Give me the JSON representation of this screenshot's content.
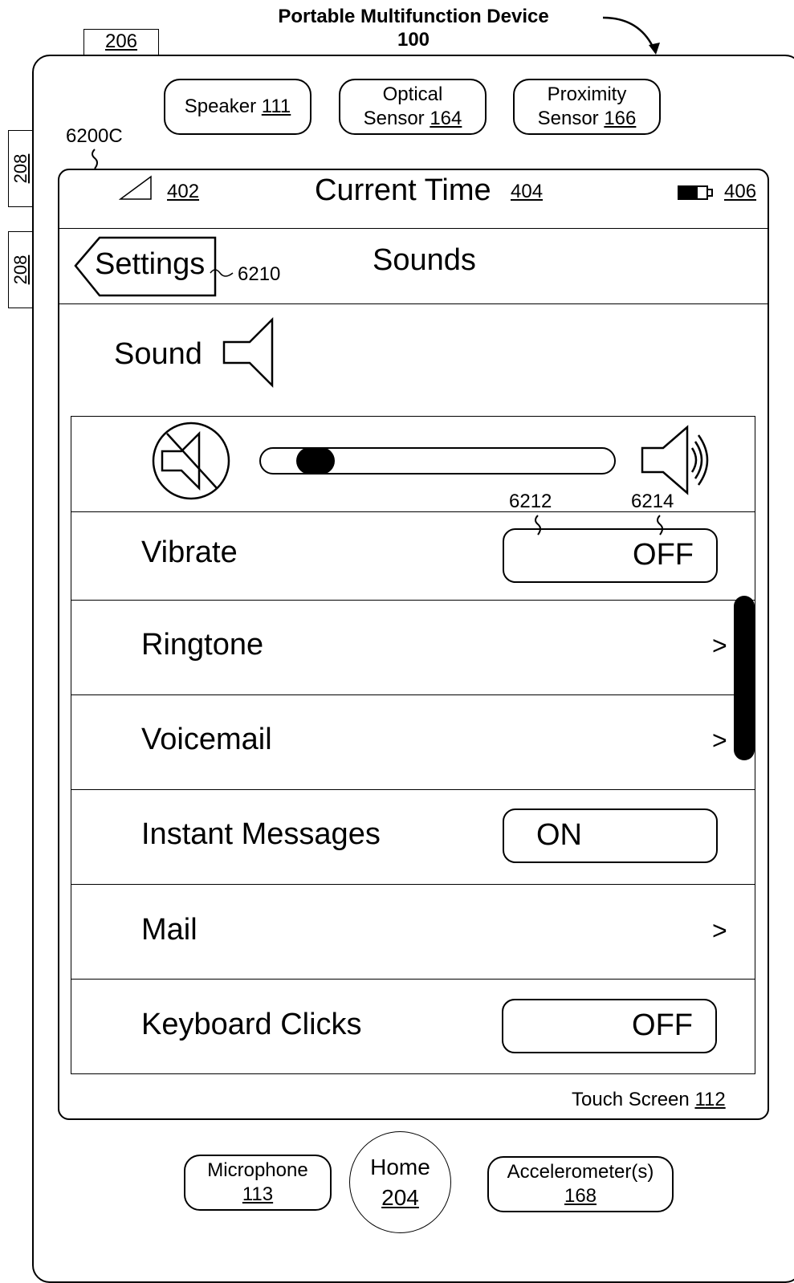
{
  "figure": {
    "title": "Portable Multifunction Device",
    "device_ref": "100",
    "tab_ref": "206",
    "side_button_ref": "208",
    "screen_ref": "6200C",
    "settings_button_ref": "6210",
    "toggle_track_ref": "6212",
    "toggle_thumb_ref": "6214"
  },
  "hardware": {
    "speaker": {
      "label": "Speaker",
      "ref": "111"
    },
    "optical_sensor": {
      "line1": "Optical",
      "label": "Sensor",
      "ref": "164"
    },
    "proximity_sensor": {
      "line1": "Proximity",
      "label": "Sensor",
      "ref": "166"
    },
    "microphone": {
      "label": "Microphone",
      "ref": "113"
    },
    "home": {
      "label": "Home",
      "ref": "204"
    },
    "accelerometer": {
      "label": "Accelerometer(s)",
      "ref": "168"
    }
  },
  "status_bar": {
    "signal_ref": "402",
    "time_label": "Current Time",
    "time_ref": "404",
    "battery_ref": "406"
  },
  "nav": {
    "back_label": "Settings",
    "title": "Sounds"
  },
  "sound_header": {
    "label": "Sound"
  },
  "volume": {
    "level": 0.1
  },
  "rows": {
    "vibrate": {
      "label": "Vibrate",
      "state": "OFF"
    },
    "ringtone": {
      "label": "Ringtone",
      "chevron": ">"
    },
    "voicemail": {
      "label": "Voicemail",
      "chevron": ">"
    },
    "instant_messages": {
      "label": "Instant Messages",
      "state": "ON"
    },
    "mail": {
      "label": "Mail",
      "chevron": ">"
    },
    "keyboard_clicks": {
      "label": "Keyboard Clicks",
      "state": "OFF"
    }
  },
  "touch_screen": {
    "label": "Touch Screen",
    "ref": "112"
  }
}
